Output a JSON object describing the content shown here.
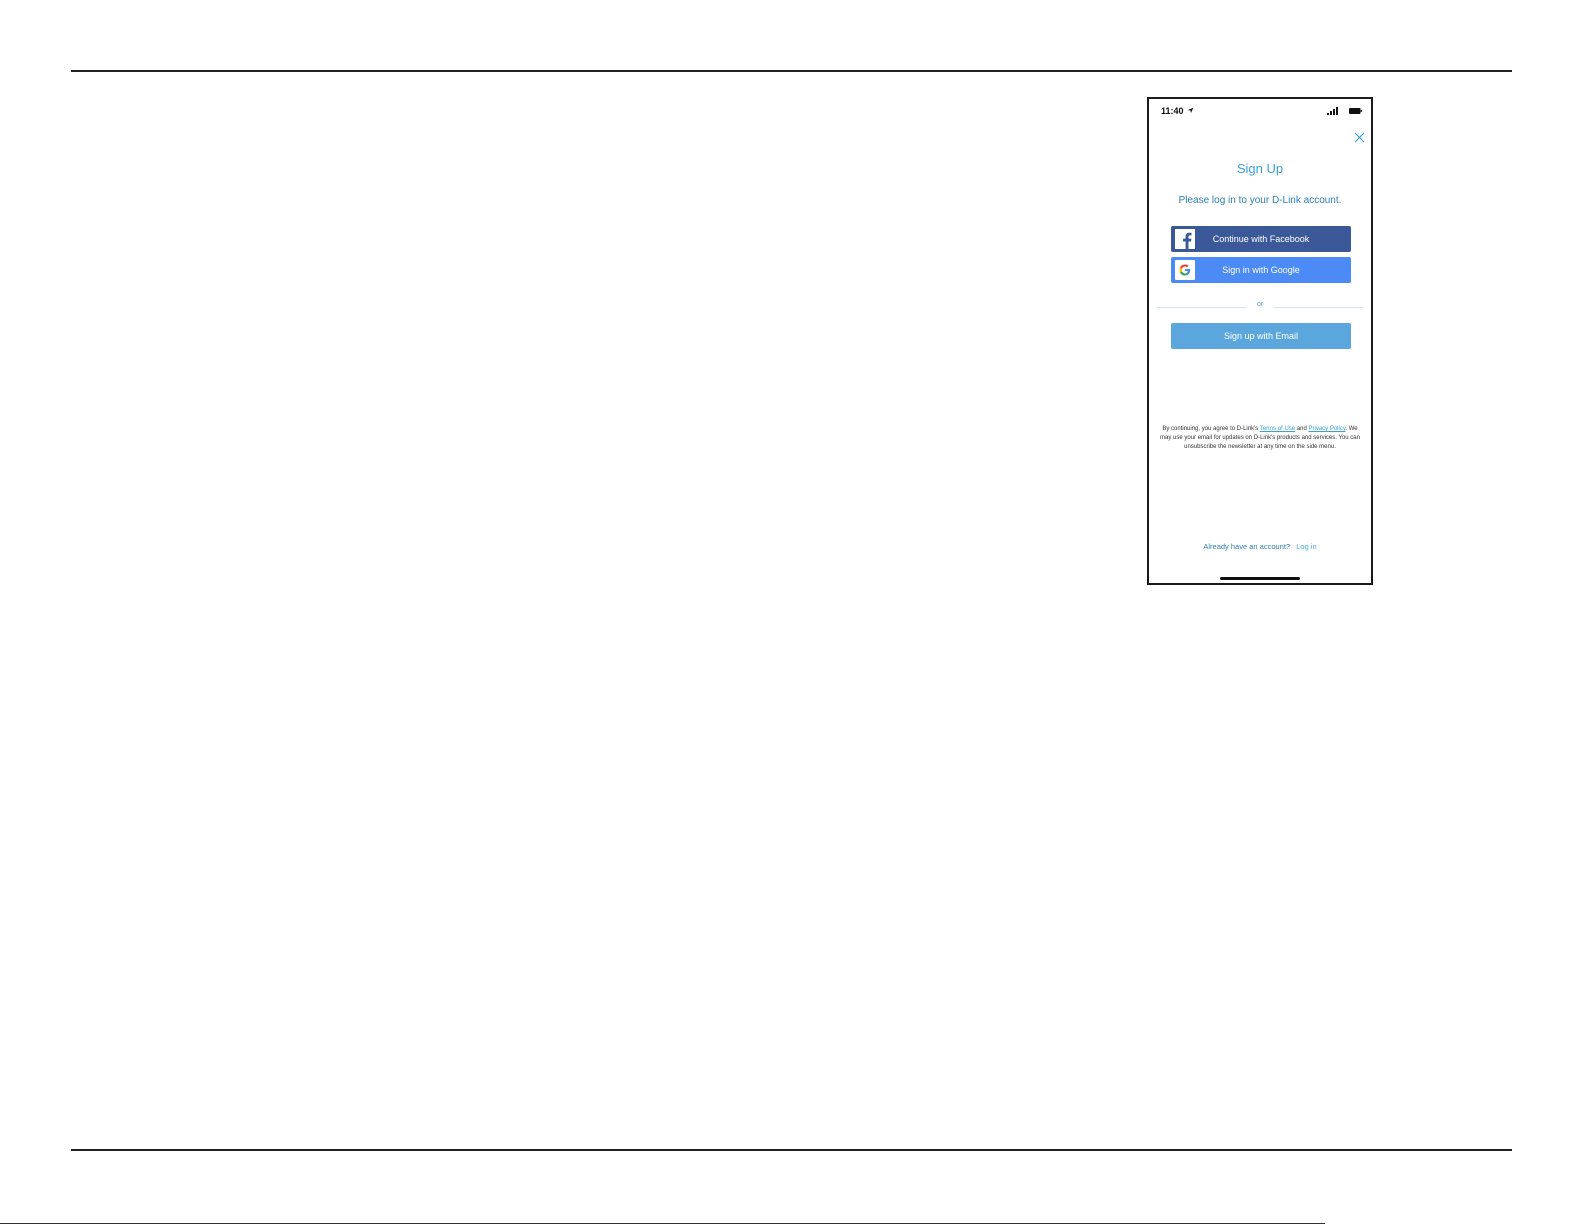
{
  "phone": {
    "status_bar": {
      "time": "11:40",
      "icons": [
        "location-arrow-icon",
        "cellular-signal-icon",
        "battery-icon"
      ]
    },
    "close_icon": "close-icon",
    "title": "Sign Up",
    "subtitle": "Please log in to your D-Link account.",
    "buttons": {
      "facebook": {
        "label": "Continue with Facebook",
        "icon": "facebook-icon",
        "color": "#3b5998"
      },
      "google": {
        "label": "Sign in with Google",
        "icon": "google-icon",
        "color": "#4c8bf5"
      },
      "email": {
        "label": "Sign up with Email",
        "color": "#5ba7dd"
      }
    },
    "divider_text": "or",
    "legal": {
      "prefix": "By continuing, you agree to D-Link's",
      "terms_link": "Terms of Use",
      "conjunction": "and",
      "privacy_link": "Privacy Policy",
      "suffix": ". We may use your email for updates on D-Link's products and services. You can unsubscribe the newsletter at any time on the side menu."
    },
    "account_prompt": {
      "text": "Already have an account?",
      "link": "Log in"
    },
    "colors": {
      "accent": "#3aa0d8",
      "text_blue": "#2a7fb3"
    }
  }
}
